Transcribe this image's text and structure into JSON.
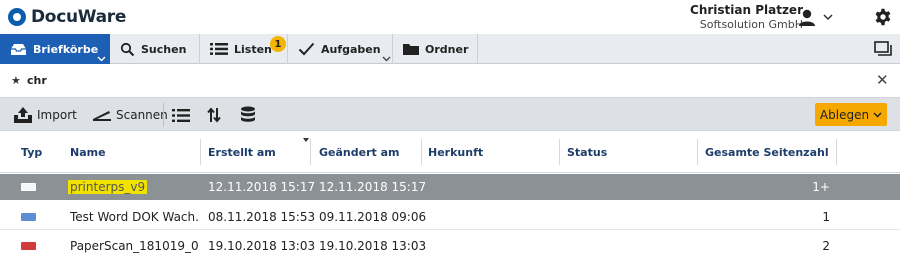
{
  "app": {
    "brand": "DocuWare",
    "user_name": "Christian Platzer",
    "user_company": "Softsolution GmbH"
  },
  "nav": {
    "tabs": [
      {
        "label": "Briefkörbe",
        "icon": "inbox-icon",
        "active": true
      },
      {
        "label": "Suchen",
        "icon": "search-icon"
      },
      {
        "label": "Listen",
        "icon": "list-icon",
        "badge": "1"
      },
      {
        "label": "Aufgaben",
        "icon": "checkmark-icon"
      },
      {
        "label": "Ordner",
        "icon": "folder-icon"
      }
    ]
  },
  "folder": {
    "name": "chr"
  },
  "toolbar": {
    "import_label": "Import",
    "scan_label": "Scannen",
    "file_label": "Ablegen"
  },
  "table": {
    "columns": [
      "Typ",
      "Name",
      "Erstellt am",
      "Geändert am",
      "Herkunft",
      "Status",
      "Gesamte Seitenzahl"
    ],
    "rows": [
      {
        "type": "blank",
        "name": "printerps_v9",
        "created": "12.11.2018 15:17",
        "modified": "12.11.2018 15:17",
        "origin": "",
        "status": "",
        "pages": "1+",
        "selected": true
      },
      {
        "type": "doc",
        "name": "Test Word DOK Wach...",
        "created": "08.11.2018 15:53",
        "modified": "09.11.2018 09:06",
        "origin": "",
        "status": "",
        "pages": "1",
        "selected": false
      },
      {
        "type": "pdf",
        "name": "PaperScan_181019_0",
        "created": "19.10.2018 13:03",
        "modified": "19.10.2018 13:03",
        "origin": "",
        "status": "",
        "pages": "2",
        "selected": false
      }
    ]
  },
  "colors": {
    "accent": "#1d5fb5",
    "highlight": "#f2e200",
    "file_button": "#f5a800",
    "selected_row": "#8c9196"
  }
}
